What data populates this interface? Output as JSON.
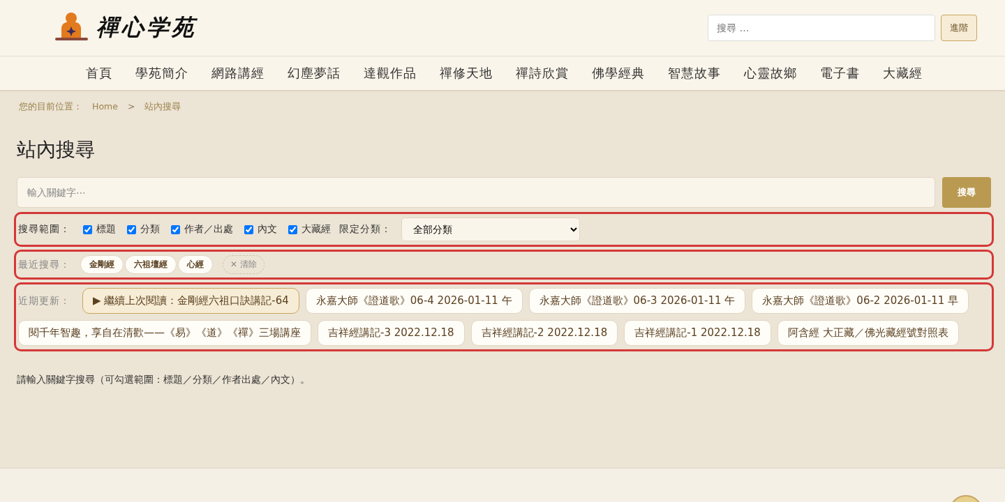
{
  "header": {
    "logo_text": "禪心学苑",
    "search": {
      "placeholder": "搜尋 …"
    },
    "advanced_button": "進階"
  },
  "nav": [
    "首頁",
    "學苑簡介",
    "網路講經",
    "幻塵夢話",
    "達觀作品",
    "禪修天地",
    "禪詩欣賞",
    "佛學經典",
    "智慧故事",
    "心靈故鄉",
    "電子書",
    "大藏經"
  ],
  "breadcrumb": {
    "label": "您的目前位置：",
    "items": [
      "Home",
      "站內搜尋"
    ],
    "separator": ">"
  },
  "title": "站內搜尋",
  "search": {
    "placeholder": "輸入關鍵字⋯",
    "button": "搜尋"
  },
  "scope": {
    "label": "搜尋範圍：",
    "options": [
      {
        "label": "標題",
        "checked": true
      },
      {
        "label": "分類",
        "checked": true
      },
      {
        "label": "作者／出處",
        "checked": true
      },
      {
        "label": "內文",
        "checked": true
      },
      {
        "label": "大藏經",
        "checked": true
      }
    ],
    "category_label": "限定分類：",
    "category_value": "全部分類"
  },
  "recent": {
    "label": "最近搜尋：",
    "items": [
      "金剛經",
      "六祖壇經",
      "心經"
    ],
    "clear": "✕ 清除"
  },
  "updates": {
    "label": "近期更新：",
    "items": [
      {
        "kind": "continue",
        "text": "▶ 繼續上次閱讀：金剛經六祖口訣講記-64"
      },
      {
        "kind": "link",
        "text": "永嘉大師《證道歌》06-4 2026-01-11 午"
      },
      {
        "kind": "link",
        "text": "永嘉大師《證道歌》06-3 2026-01-11 午"
      },
      {
        "kind": "link",
        "text": "永嘉大師《證道歌》06-2 2026-01-11 早"
      },
      {
        "kind": "link",
        "text": "閱千年智趣，享自在清歡——《易》《道》《禪》三場講座"
      },
      {
        "kind": "link",
        "text": "吉祥經講記-3 2022.12.18"
      },
      {
        "kind": "link",
        "text": "吉祥經講記-2 2022.12.18"
      },
      {
        "kind": "link",
        "text": "吉祥經講記-1 2022.12.18"
      },
      {
        "kind": "link",
        "text": "阿含經 大正藏／佛光藏經號對照表"
      }
    ]
  },
  "hint": "請輸入關鍵字搜尋（可勾選範圍：標題／分類／作者出處／內文）。"
}
